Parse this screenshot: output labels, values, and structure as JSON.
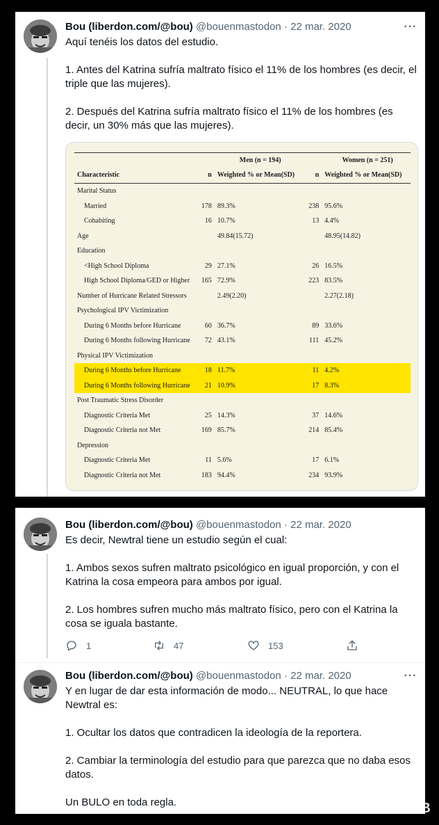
{
  "tweets": [
    {
      "name": "Bou (liberdon.com/@bou)",
      "handle": "@bouenmastodon",
      "sep": "·",
      "date": "22 mar. 2020",
      "paragraphs": [
        "Aquí tenéis los datos del estudio.",
        "1. Antes del Katrina sufría maltrato físico el 11% de los hombres (es decir, el triple que las mujeres).",
        "2. Después del Katrina sufría maltrato físico el 11% de los hombres (es decir, un 30% más que las mujeres)."
      ]
    },
    {
      "name": "Bou (liberdon.com/@bou)",
      "handle": "@bouenmastodon",
      "sep": "·",
      "date": "22 mar. 2020",
      "paragraphs": [
        "Es decir, Newtral tiene un estudio según el cual:",
        "1. Ambos sexos sufren maltrato psicológico en igual proporción, y con el Katrina la cosa empeora para ambos por igual.",
        "2. Los hombres sufren mucho más maltrato físico, pero con el Katrina la cosa se iguala bastante."
      ],
      "actions": {
        "replies": "1",
        "retweets": "47",
        "likes": "153"
      }
    },
    {
      "name": "Bou (liberdon.com/@bou)",
      "handle": "@bouenmastodon",
      "sep": "·",
      "date": "22 mar. 2020",
      "paragraphs": [
        "Y en lugar de dar esta información de modo... NEUTRAL, lo que hace Newtral es:",
        "1. Ocultar los datos que contradicen la ideología de la reportera.",
        "2. Cambiar la terminología del estudio para que parezca que no daba esos datos.",
        "Un BULO en toda regla."
      ]
    }
  ],
  "more_icon": "···",
  "study_table": {
    "group_headers": {
      "men": "Men (n = 194)",
      "women": "Women (n = 251)"
    },
    "columns": [
      "Characteristic",
      "n",
      "Weighted % or Mean(SD)",
      "n",
      "Weighted % or Mean(SD)"
    ],
    "rows": [
      {
        "label": "Marital Status",
        "indent": false,
        "mn": "",
        "mv": "",
        "wn": "",
        "wv": ""
      },
      {
        "label": "Married",
        "indent": true,
        "mn": "178",
        "mv": "89.3%",
        "wn": "238",
        "wv": "95.6%"
      },
      {
        "label": "Cohabiting",
        "indent": true,
        "mn": "16",
        "mv": "10.7%",
        "wn": "13",
        "wv": "4.4%"
      },
      {
        "label": "Age",
        "indent": false,
        "mn": "",
        "mv": "49.84(15.72)",
        "wn": "",
        "wv": "48.95(14.82)"
      },
      {
        "label": "Education",
        "indent": false,
        "mn": "",
        "mv": "",
        "wn": "",
        "wv": ""
      },
      {
        "label": "<High School Diploma",
        "indent": true,
        "mn": "29",
        "mv": "27.1%",
        "wn": "26",
        "wv": "16.5%"
      },
      {
        "label": "High School Diploma/GED or Higher",
        "indent": true,
        "mn": "165",
        "mv": "72.9%",
        "wn": "223",
        "wv": "83.5%"
      },
      {
        "label": "Number of Hurricane Related Stressors",
        "indent": false,
        "mn": "",
        "mv": "2.49(2.20)",
        "wn": "",
        "wv": "2.27(2.18)"
      },
      {
        "label": "Psychological IPV Victimization",
        "indent": false,
        "mn": "",
        "mv": "",
        "wn": "",
        "wv": ""
      },
      {
        "label": "During 6 Months before Hurricane",
        "indent": true,
        "mn": "60",
        "mv": "36.7%",
        "wn": "89",
        "wv": "33.6%"
      },
      {
        "label": "During 6 Months following Hurricane",
        "indent": true,
        "mn": "72",
        "mv": "43.1%",
        "wn": "111",
        "wv": "45.2%"
      },
      {
        "label": "Physical IPV Victimization",
        "indent": false,
        "mn": "",
        "mv": "",
        "wn": "",
        "wv": ""
      },
      {
        "label": "During 6 Months before Hurricane",
        "indent": true,
        "mn": "18",
        "mv": "11.7%",
        "wn": "11",
        "wv": "4.2%",
        "highlight": true
      },
      {
        "label": "During 6 Months following Hurricane",
        "indent": true,
        "mn": "21",
        "mv": "10.9%",
        "wn": "17",
        "wv": "8.3%",
        "highlight": true
      },
      {
        "label": "Post Traumatic Stress Disorder",
        "indent": false,
        "mn": "",
        "mv": "",
        "wn": "",
        "wv": ""
      },
      {
        "label": "Diagnostic Criteria Met",
        "indent": true,
        "mn": "25",
        "mv": "14.3%",
        "wn": "37",
        "wv": "14.6%"
      },
      {
        "label": "Diagnostic Criteria not Met",
        "indent": true,
        "mn": "169",
        "mv": "85.7%",
        "wn": "214",
        "wv": "85.4%"
      },
      {
        "label": "Depression",
        "indent": false,
        "mn": "",
        "mv": "",
        "wn": "",
        "wv": ""
      },
      {
        "label": "Diagnostic Criteria Met",
        "indent": true,
        "mn": "11",
        "mv": "5.6%",
        "wn": "17",
        "wv": "6.1%"
      },
      {
        "label": "Diagnostic Criteria not Met",
        "indent": true,
        "mn": "183",
        "mv": "94.4%",
        "wn": "234",
        "wv": "93.9%"
      }
    ],
    "highlight_color": "#ffe400"
  },
  "watermark": "HdB",
  "colors": {
    "text": "#0f1419",
    "muted": "#536471",
    "divider": "#cfd9de",
    "background": "#000000"
  }
}
